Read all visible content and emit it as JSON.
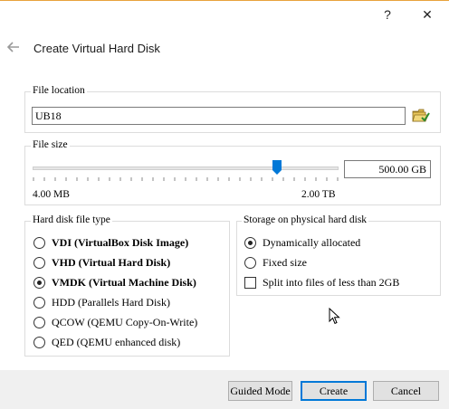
{
  "window": {
    "help_label": "?",
    "close_label": "✕"
  },
  "header": {
    "title": "Create Virtual Hard Disk",
    "back_icon": "arrow-left-icon"
  },
  "file_location": {
    "label": "File location",
    "value": "UB18",
    "folder_icon": "folder-open-icon"
  },
  "file_size": {
    "label": "File size",
    "min_label": "4.00 MB",
    "max_label": "2.00 TB",
    "value": "500.00 GB",
    "slider_fraction": 0.8
  },
  "disk_type": {
    "label": "Hard disk file type",
    "options": [
      {
        "label": "VDI (VirtualBox Disk Image)",
        "selected": false
      },
      {
        "label": "VHD (Virtual Hard Disk)",
        "selected": false
      },
      {
        "label": "VMDK (Virtual Machine Disk)",
        "selected": true
      },
      {
        "label": "HDD (Parallels Hard Disk)",
        "selected": false
      },
      {
        "label": "QCOW (QEMU Copy-On-Write)",
        "selected": false
      },
      {
        "label": "QED (QEMU enhanced disk)",
        "selected": false
      }
    ]
  },
  "storage": {
    "label": "Storage on physical hard disk",
    "dynamic_label": "Dynamically allocated",
    "dynamic_selected": true,
    "fixed_label": "Fixed size",
    "fixed_selected": false,
    "split_label": "Split into files of less than 2GB",
    "split_checked": false
  },
  "buttons": {
    "guided": "Guided Mode",
    "create": "Create",
    "cancel": "Cancel"
  }
}
